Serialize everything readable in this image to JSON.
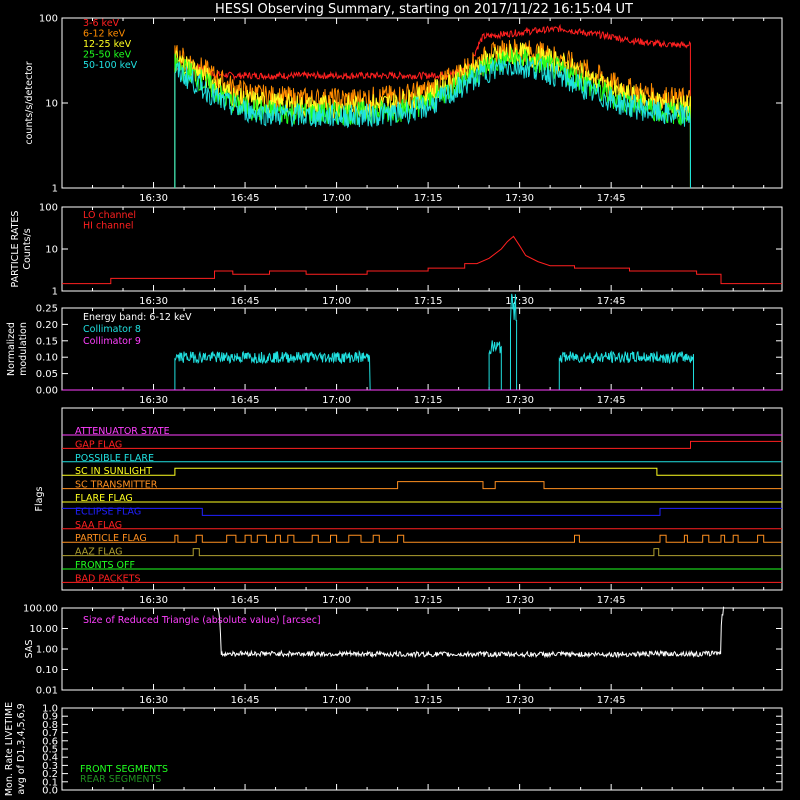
{
  "title": "HESSI Observing Summary, starting on 2017/11/22 16:15:04 UT",
  "colors": {
    "red": "#ff2020",
    "orange": "#ff9020",
    "yellow": "#ffff20",
    "green": "#20ff20",
    "cyan": "#20e0e0",
    "magenta": "#ff40ff",
    "blue": "#2020ff",
    "white": "#ffffff",
    "darkgreen": "#209020",
    "olive": "#b0a030"
  },
  "chart_data": [
    {
      "type": "line",
      "panel": "lightcurves",
      "ylabel": "counts/s/detector",
      "yscale": "log",
      "ylim": [
        1,
        100
      ],
      "yticks": [
        "1",
        "10",
        "100"
      ],
      "xlim_minutes_after_16_15": [
        0,
        105
      ],
      "xticks": [
        "16:30",
        "16:45",
        "17:00",
        "17:15",
        "17:30",
        "17:45"
      ],
      "series": [
        {
          "name": "3-6 keV",
          "color": "#ff2020",
          "points": [
            [
              18.5,
              1
            ],
            [
              18.5,
              26
            ],
            [
              23,
              26
            ],
            [
              25,
              22
            ],
            [
              28,
              21
            ],
            [
              33,
              21
            ],
            [
              43,
              21
            ],
            [
              52,
              21
            ],
            [
              60,
              21
            ],
            [
              64,
              22
            ],
            [
              67,
              28
            ],
            [
              69,
              60
            ],
            [
              72,
              64
            ],
            [
              77,
              70
            ],
            [
              82,
              75
            ],
            [
              85,
              68
            ],
            [
              89,
              62
            ],
            [
              93,
              55
            ],
            [
              97,
              50
            ],
            [
              101,
              48
            ],
            [
              103,
              48
            ],
            [
              103,
              1
            ]
          ]
        },
        {
          "name": "6-12 keV",
          "color": "#ff8c00",
          "points": [
            [
              18.5,
              1
            ],
            [
              18.5,
              36
            ],
            [
              20,
              33
            ],
            [
              23,
              25
            ],
            [
              26,
              18
            ],
            [
              29,
              14
            ],
            [
              33,
              12
            ],
            [
              40,
              11
            ],
            [
              48,
              11
            ],
            [
              55,
              12
            ],
            [
              60,
              14
            ],
            [
              64,
              20
            ],
            [
              67,
              28
            ],
            [
              70,
              36
            ],
            [
              73,
              42
            ],
            [
              75,
              43
            ],
            [
              77,
              40
            ],
            [
              79,
              38
            ],
            [
              81,
              35
            ],
            [
              84,
              28
            ],
            [
              87,
              22
            ],
            [
              91,
              16
            ],
            [
              95,
              13
            ],
            [
              98,
              12
            ],
            [
              101,
              11
            ],
            [
              103,
              11
            ],
            [
              103,
              1
            ]
          ]
        },
        {
          "name": "12-25 keV",
          "color": "#ffff20",
          "points": [
            [
              18.5,
              1
            ],
            [
              18.5,
              32
            ],
            [
              20,
              29
            ],
            [
              23,
              21
            ],
            [
              26,
              15
            ],
            [
              29,
              11
            ],
            [
              33,
              10
            ],
            [
              40,
              9
            ],
            [
              48,
              9
            ],
            [
              55,
              10
            ],
            [
              60,
              12
            ],
            [
              64,
              18
            ],
            [
              67,
              24
            ],
            [
              70,
              32
            ],
            [
              73,
              37
            ],
            [
              75,
              38
            ],
            [
              77,
              35
            ],
            [
              79,
              33
            ],
            [
              81,
              30
            ],
            [
              84,
              24
            ],
            [
              87,
              18
            ],
            [
              91,
              13
            ],
            [
              95,
              11
            ],
            [
              98,
              10
            ],
            [
              101,
              9
            ],
            [
              103,
              9
            ],
            [
              103,
              1
            ]
          ]
        },
        {
          "name": "25-50 keV",
          "color": "#20ff20",
          "points": [
            [
              18.5,
              1
            ],
            [
              18.5,
              28
            ],
            [
              20,
              25
            ],
            [
              23,
              18
            ],
            [
              26,
              12
            ],
            [
              29,
              9
            ],
            [
              33,
              8
            ],
            [
              40,
              7.5
            ],
            [
              48,
              7.5
            ],
            [
              55,
              8
            ],
            [
              60,
              10
            ],
            [
              64,
              15
            ],
            [
              67,
              21
            ],
            [
              70,
              28
            ],
            [
              73,
              32
            ],
            [
              75,
              33
            ],
            [
              77,
              30
            ],
            [
              79,
              28
            ],
            [
              81,
              25
            ],
            [
              84,
              20
            ],
            [
              87,
              15
            ],
            [
              91,
              11
            ],
            [
              95,
              9
            ],
            [
              98,
              8
            ],
            [
              101,
              7.5
            ],
            [
              103,
              7.5
            ],
            [
              103,
              1
            ]
          ]
        },
        {
          "name": "50-100 keV",
          "color": "#20e0e0",
          "points": [
            [
              18.5,
              1
            ],
            [
              18.5,
              24
            ],
            [
              20,
              21
            ],
            [
              23,
              15
            ],
            [
              26,
              10.5
            ],
            [
              29,
              8.5
            ],
            [
              33,
              7.5
            ],
            [
              40,
              7
            ],
            [
              48,
              7
            ],
            [
              55,
              7.5
            ],
            [
              60,
              9
            ],
            [
              64,
              13
            ],
            [
              67,
              18
            ],
            [
              70,
              24
            ],
            [
              73,
              27
            ],
            [
              75,
              27
            ],
            [
              77,
              26
            ],
            [
              79,
              24
            ],
            [
              81,
              21
            ],
            [
              84,
              17
            ],
            [
              87,
              13
            ],
            [
              91,
              10
            ],
            [
              95,
              8.5
            ],
            [
              98,
              7.5
            ],
            [
              101,
              7
            ],
            [
              103,
              7
            ],
            [
              103,
              1
            ]
          ]
        }
      ]
    },
    {
      "type": "line",
      "panel": "particle_rates",
      "ylabel": "PARTICLE RATES Counts/s",
      "yscale": "log",
      "ylim": [
        1,
        100
      ],
      "yticks": [
        "1",
        "10",
        "100"
      ],
      "xticks": [
        "16:30",
        "16:45",
        "17:00",
        "17:15",
        "17:30",
        "17:45"
      ],
      "series": [
        {
          "name": "LO channel",
          "color": "#ff2020",
          "points": []
        },
        {
          "name": "HI channel",
          "color": "#ff2020",
          "points": [
            [
              0,
              1.5
            ],
            [
              8,
              1.5
            ],
            [
              8,
              2
            ],
            [
              25,
              2
            ],
            [
              25,
              3
            ],
            [
              28,
              3
            ],
            [
              28,
              2.5
            ],
            [
              34,
              2.5
            ],
            [
              34,
              3
            ],
            [
              40,
              3
            ],
            [
              40,
              2.5
            ],
            [
              50,
              2.5
            ],
            [
              50,
              3
            ],
            [
              60,
              3
            ],
            [
              60,
              3.5
            ],
            [
              66,
              3.5
            ],
            [
              66,
              4.5
            ],
            [
              68,
              4.5
            ],
            [
              70,
              6
            ],
            [
              72,
              10
            ],
            [
              73,
              15
            ],
            [
              74,
              20
            ],
            [
              75,
              12
            ],
            [
              76,
              7
            ],
            [
              78,
              5
            ],
            [
              80,
              4
            ],
            [
              84,
              4
            ],
            [
              84,
              3.5
            ],
            [
              93,
              3.5
            ],
            [
              93,
              3
            ],
            [
              104,
              3
            ],
            [
              104,
              2.5
            ],
            [
              108,
              2.5
            ],
            [
              108,
              1.5
            ],
            [
              118,
              1.5
            ]
          ]
        }
      ]
    },
    {
      "type": "line",
      "panel": "modulation",
      "ylabel": "Normalized modulation",
      "ylim": [
        0,
        0.25
      ],
      "yticks": [
        "0.00",
        "0.05",
        "0.10",
        "0.15",
        "0.20",
        "0.25"
      ],
      "annotation": "Energy band: 6-12 keV",
      "xticks": [
        "16:30",
        "16:45",
        "17:00",
        "17:15",
        "17:30",
        "17:45"
      ],
      "series": [
        {
          "name": "Collimator 8",
          "color": "#20e0e0",
          "segments": [
            [
              18.5,
              50.5,
              0.1
            ],
            [
              70,
              72,
              0.13
            ],
            [
              73.5,
              74.5,
              0.25
            ],
            [
              81.5,
              103.5,
              0.1
            ]
          ]
        },
        {
          "name": "Collimator 9",
          "color": "#ff40ff",
          "segments": [
            [
              0,
              118,
              0.0
            ]
          ]
        }
      ]
    },
    {
      "type": "table",
      "panel": "flags",
      "ylabel": "Flags",
      "xticks": [
        "16:30",
        "16:45",
        "17:00",
        "17:15",
        "17:30",
        "17:45"
      ],
      "flags": [
        {
          "name": "ATTENUATOR STATE",
          "color": "#ff40ff"
        },
        {
          "name": "GAP FLAG",
          "color": "#ff2020"
        },
        {
          "name": "POSSIBLE FLARE",
          "color": "#20e0e0"
        },
        {
          "name": "SC IN SUNLIGHT",
          "color": "#ffff20"
        },
        {
          "name": "SC TRANSMITTER",
          "color": "#ff9020"
        },
        {
          "name": "FLARE FLAG",
          "color": "#ffff20"
        },
        {
          "name": "ECLIPSE FLAG",
          "color": "#2020ff"
        },
        {
          "name": "SAA FLAG",
          "color": "#ff2020"
        },
        {
          "name": "PARTICLE FLAG",
          "color": "#ff9020"
        },
        {
          "name": "AAZ FLAG",
          "color": "#b0a030"
        },
        {
          "name": "FRONTS OFF",
          "color": "#20ff20"
        },
        {
          "name": "BAD PACKETS",
          "color": "#ff2020"
        }
      ]
    },
    {
      "type": "line",
      "panel": "sas",
      "ylabel": "SAS",
      "yscale": "log",
      "ylim": [
        0.01,
        100
      ],
      "yticks": [
        "0.01",
        "0.10",
        "1.00",
        "10.00",
        "100.00"
      ],
      "annotation": "Size of Reduced Triangle (absolute value) [arcsec]",
      "xticks": [
        "16:30",
        "16:45",
        "17:00",
        "17:15",
        "17:30",
        "17:45"
      ],
      "series": [
        {
          "name": "triangle",
          "color": "#ffffff",
          "points": [
            [
              25.5,
              100
            ],
            [
              26,
              0.5
            ],
            [
              27,
              0.6
            ],
            [
              30,
              0.6
            ],
            [
              60,
              0.55
            ],
            [
              90,
              0.55
            ],
            [
              102,
              0.6
            ],
            [
              104,
              0.55
            ],
            [
              106,
              0.6
            ],
            [
              108,
              0.7
            ],
            [
              108.5,
              100
            ]
          ]
        }
      ]
    },
    {
      "type": "line",
      "panel": "livetime",
      "ylabel": "Mon. Rate LIVETIME avg of D1,3,4,5,6,9",
      "ylim": [
        0,
        1
      ],
      "yticks": [
        "0.0",
        "0.1",
        "0.2",
        "0.3",
        "0.4",
        "0.5",
        "0.6",
        "0.7",
        "0.8",
        "0.9",
        "1.0"
      ],
      "series": [
        {
          "name": "FRONT SEGMENTS",
          "color": "#20ff20",
          "points": []
        },
        {
          "name": "REAR SEGMENTS",
          "color": "#209020",
          "points": []
        }
      ]
    }
  ]
}
